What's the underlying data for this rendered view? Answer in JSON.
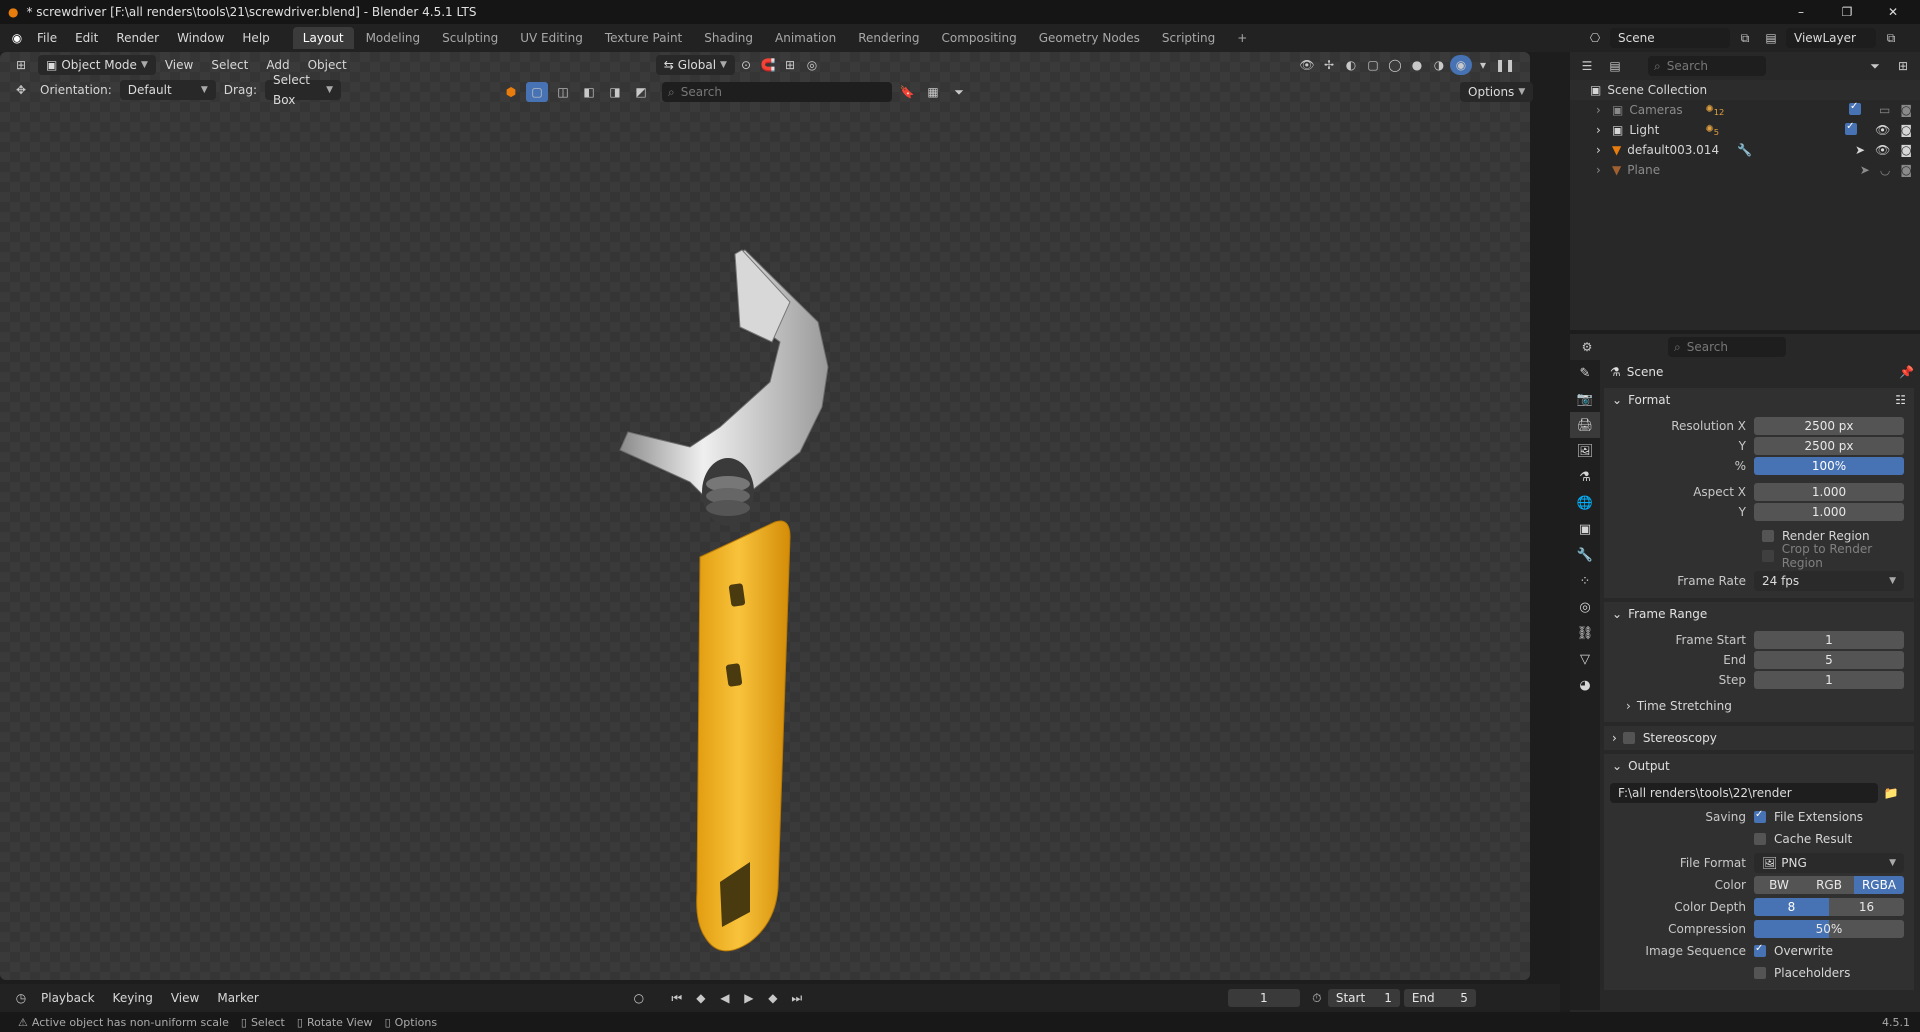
{
  "window": {
    "title": "* screwdriver [F:\\all renders\\tools\\21\\screwdriver.blend] - Blender 4.5.1 LTS",
    "minimize": "–",
    "maximize": "❐",
    "close": "✕"
  },
  "menu": [
    "File",
    "Edit",
    "Render",
    "Window",
    "Help"
  ],
  "workspaces": [
    "Layout",
    "Modeling",
    "Sculpting",
    "UV Editing",
    "Texture Paint",
    "Shading",
    "Animation",
    "Rendering",
    "Compositing",
    "Geometry Nodes",
    "Scripting"
  ],
  "active_workspace": "Layout",
  "scene_name": "Scene",
  "view_layer": "ViewLayer",
  "viewport": {
    "mode": "Object Mode",
    "menus": [
      "View",
      "Select",
      "Add",
      "Object"
    ],
    "transform_orientation": "Global",
    "orientation_label": "Orientation:",
    "orientation_value": "Default",
    "drag_label": "Drag:",
    "drag_value": "Select Box",
    "search_placeholder": "Search",
    "options": "Options"
  },
  "outliner": {
    "search_placeholder": "Search",
    "root": "Scene Collection",
    "items": [
      {
        "name": "Cameras",
        "badge": "12"
      },
      {
        "name": "Light",
        "badge": "5"
      },
      {
        "name": "default003.014",
        "badge": ""
      },
      {
        "name": "Plane",
        "badge": ""
      }
    ]
  },
  "properties": {
    "search_placeholder": "Search",
    "context": "Scene",
    "format": {
      "title": "Format",
      "resolution_x_label": "Resolution X",
      "resolution_x": "2500 px",
      "resolution_y_label": "Y",
      "resolution_y": "2500 px",
      "percent_label": "%",
      "percent": "100%",
      "aspect_x_label": "Aspect X",
      "aspect_x": "1.000",
      "aspect_y_label": "Y",
      "aspect_y": "1.000",
      "render_region": "Render Region",
      "crop_region": "Crop to Render Region",
      "frame_rate_label": "Frame Rate",
      "frame_rate": "24 fps"
    },
    "frame_range": {
      "title": "Frame Range",
      "start_label": "Frame Start",
      "start": "1",
      "end_label": "End",
      "end": "5",
      "step_label": "Step",
      "step": "1",
      "time_stretching": "Time Stretching"
    },
    "stereoscopy": "Stereoscopy",
    "output": {
      "title": "Output",
      "path": "F:\\all renders\\tools\\22\\render",
      "saving_label": "Saving",
      "file_extensions": "File Extensions",
      "cache_result": "Cache Result",
      "file_format_label": "File Format",
      "file_format": "PNG",
      "color_label": "Color",
      "color_options": [
        "BW",
        "RGB",
        "RGBA"
      ],
      "color_selected": "RGBA",
      "depth_label": "Color Depth",
      "depth_options": [
        "8",
        "16"
      ],
      "depth_selected": "8",
      "compression_label": "Compression",
      "compression": "50%",
      "image_sequence_label": "Image Sequence",
      "overwrite": "Overwrite",
      "placeholders": "Placeholders"
    }
  },
  "timeline": {
    "menus": [
      "Playback",
      "Keying",
      "View",
      "Marker"
    ],
    "current_frame": "1",
    "start_label": "Start",
    "start": "1",
    "end_label": "End",
    "end": "5"
  },
  "status": {
    "warning": "Active object has non-uniform scale",
    "select": "Select",
    "rotate": "Rotate View",
    "options": "Options",
    "version": "4.5.1"
  },
  "colors": {
    "accent": "#4772b3",
    "handle": "#f2b51e",
    "metal": "#cfcfcf"
  }
}
